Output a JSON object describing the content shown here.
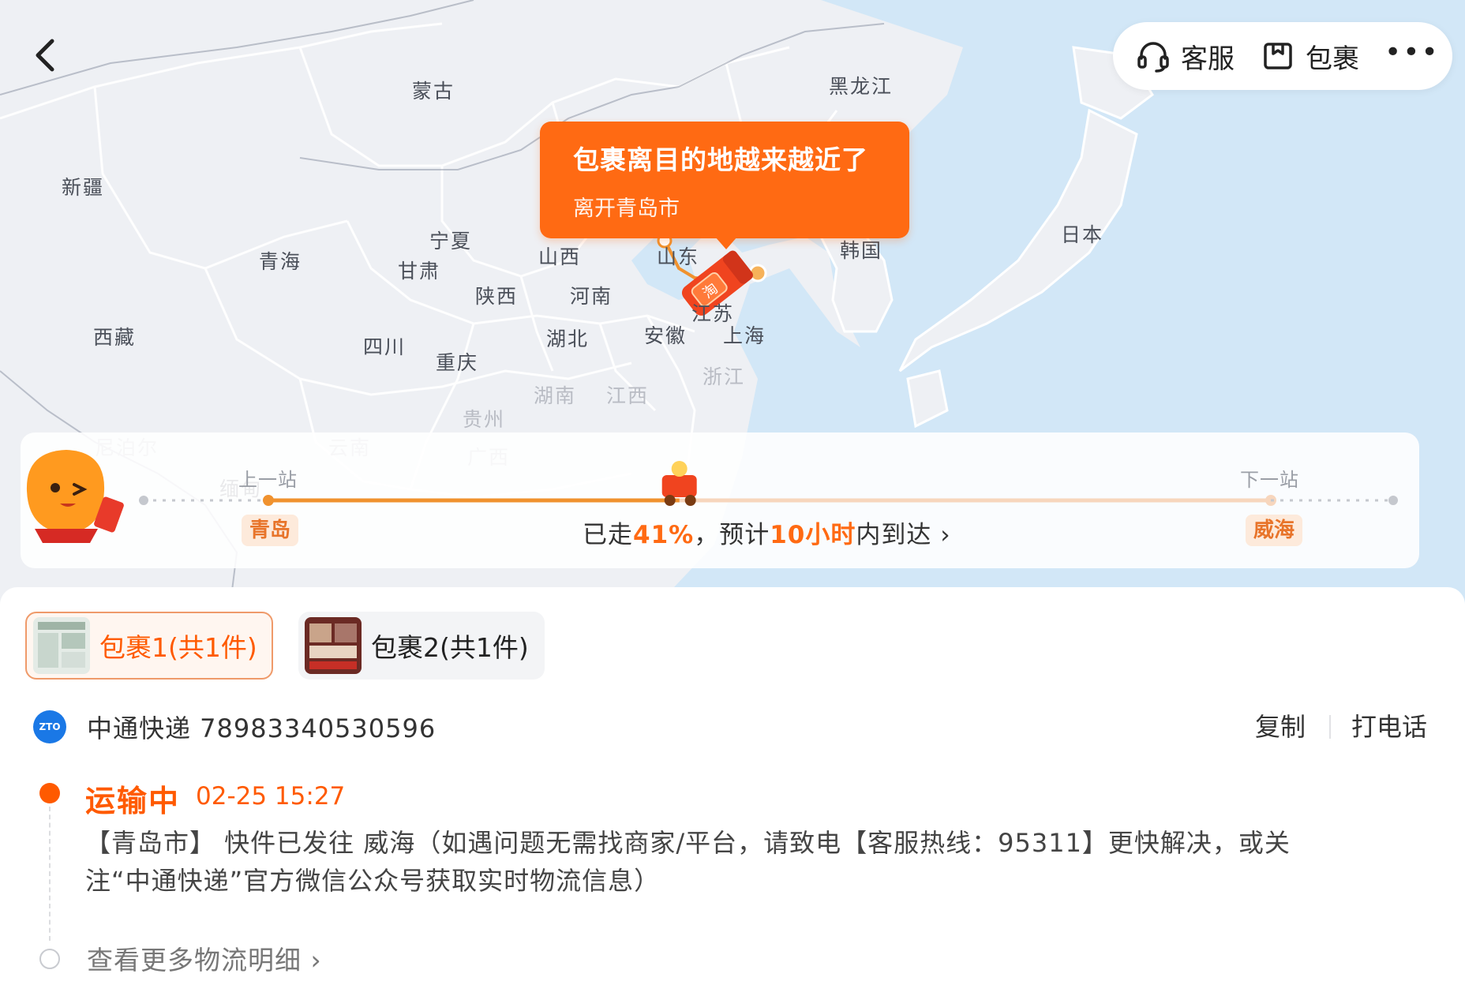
{
  "map": {
    "regions": [
      {
        "name": "蒙古",
        "faded": false
      },
      {
        "name": "黑龙江",
        "faded": false
      },
      {
        "name": "新疆",
        "faded": false
      },
      {
        "name": "河北",
        "faded": false
      },
      {
        "name": "宁夏",
        "faded": false
      },
      {
        "name": "青海",
        "faded": false
      },
      {
        "name": "甘肃",
        "faded": false
      },
      {
        "name": "山西",
        "faded": false
      },
      {
        "name": "山东",
        "faded": false
      },
      {
        "name": "韩国",
        "faded": false
      },
      {
        "name": "日本",
        "faded": false
      },
      {
        "name": "陕西",
        "faded": false
      },
      {
        "name": "河南",
        "faded": false
      },
      {
        "name": "江苏",
        "faded": false
      },
      {
        "name": "西藏",
        "faded": false
      },
      {
        "name": "安徽",
        "faded": false
      },
      {
        "name": "上海",
        "faded": false
      },
      {
        "name": "四川",
        "faded": false
      },
      {
        "name": "湖北",
        "faded": false
      },
      {
        "name": "重庆",
        "faded": false
      },
      {
        "name": "浙江",
        "faded": true
      },
      {
        "name": "湖南",
        "faded": true
      },
      {
        "name": "江西",
        "faded": true
      },
      {
        "name": "贵州",
        "faded": true
      },
      {
        "name": "尼泊尔",
        "faded": true
      },
      {
        "name": "云南",
        "faded": true
      },
      {
        "name": "广西",
        "faded": true
      },
      {
        "name": "缅甸",
        "faded": false
      }
    ]
  },
  "topbar": {
    "service_label": "客服",
    "service_icon": "headset-icon",
    "package_label": "包裹",
    "package_icon": "package-box-icon",
    "more_label": "•••"
  },
  "bubble": {
    "title": "包裹离目的地越来越近了",
    "subtitle": "离开青岛市"
  },
  "progress": {
    "prev_caption": "上一站",
    "prev_station": "青岛",
    "next_caption": "下一站",
    "next_station": "威海",
    "text_prefix": "已走",
    "percent_text": "41%",
    "text_mid": "，预计",
    "eta": "10小时",
    "text_suffix": "内到达",
    "chevron": "›",
    "fraction": 0.41
  },
  "packages": [
    {
      "label": "包裹1(共1件)",
      "selected": true
    },
    {
      "label": "包裹2(共1件)",
      "selected": false
    }
  ],
  "courier": {
    "logo_text": "ZTO",
    "name_and_number": "中通快递 78983340530596",
    "copy_label": "复制",
    "call_label": "打电话"
  },
  "tracking": {
    "status": "运输中",
    "time": "02-25 15:27",
    "description": "【青岛市】 快件已发往 威海（如遇问题无需找商家/平台，请致电【客服热线：95311】更快解决，或关注“中通快递”官方微信公众号获取实时物流信息）",
    "more_label": "查看更多物流明细 ›"
  },
  "colors": {
    "accent": "#ff6a13",
    "accent_dark": "#ff5a00",
    "tag_bg": "#fdeadb",
    "sea": "#d2e7f7",
    "land": "#eef0f4"
  }
}
